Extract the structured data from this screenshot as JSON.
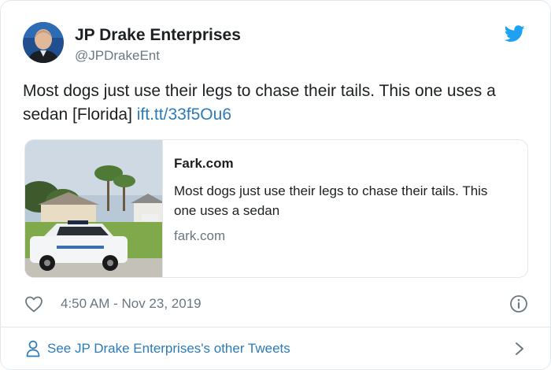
{
  "author": {
    "name": "JP Drake Enterprises",
    "handle": "@JPDrakeEnt"
  },
  "tweet": {
    "text": "Most dogs just use their legs to chase their tails. This one uses a sedan [Florida]",
    "link_text": "ift.tt/33f5Ou6"
  },
  "card": {
    "title": "Fark.com",
    "description": "Most dogs just use their legs to chase their tails. This one uses a sedan",
    "domain": "fark.com"
  },
  "meta": {
    "timestamp": "4:50 AM - Nov 23, 2019"
  },
  "footer": {
    "link_text": "See JP Drake Enterprises's other Tweets"
  },
  "icons": {
    "like": "heart-icon",
    "info": "info-icon",
    "logo": "twitter-bird-icon",
    "profile": "person-icon",
    "chevron": "chevron-right-icon"
  },
  "colors": {
    "link": "#2b7bb9",
    "secondary_text": "#697882",
    "twitter_blue": "#1da1f2",
    "border": "#e1e8ed"
  }
}
